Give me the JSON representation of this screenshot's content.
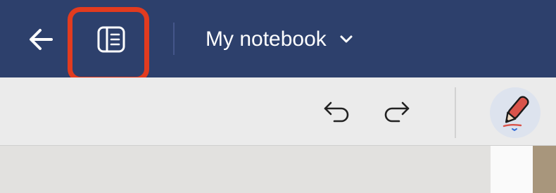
{
  "header": {
    "notebook_title": "My notebook",
    "back_icon": "arrow-left-icon",
    "sidebar_icon": "notebook-sidebar-icon",
    "dropdown_icon": "chevron-down-icon",
    "background_color": "#2d406c",
    "highlight_color": "#e23b1f"
  },
  "toolbar": {
    "undo_icon": "undo-icon",
    "redo_icon": "redo-icon",
    "active_tool_icon": "pen-icon",
    "pen_color": "#d9534a"
  }
}
